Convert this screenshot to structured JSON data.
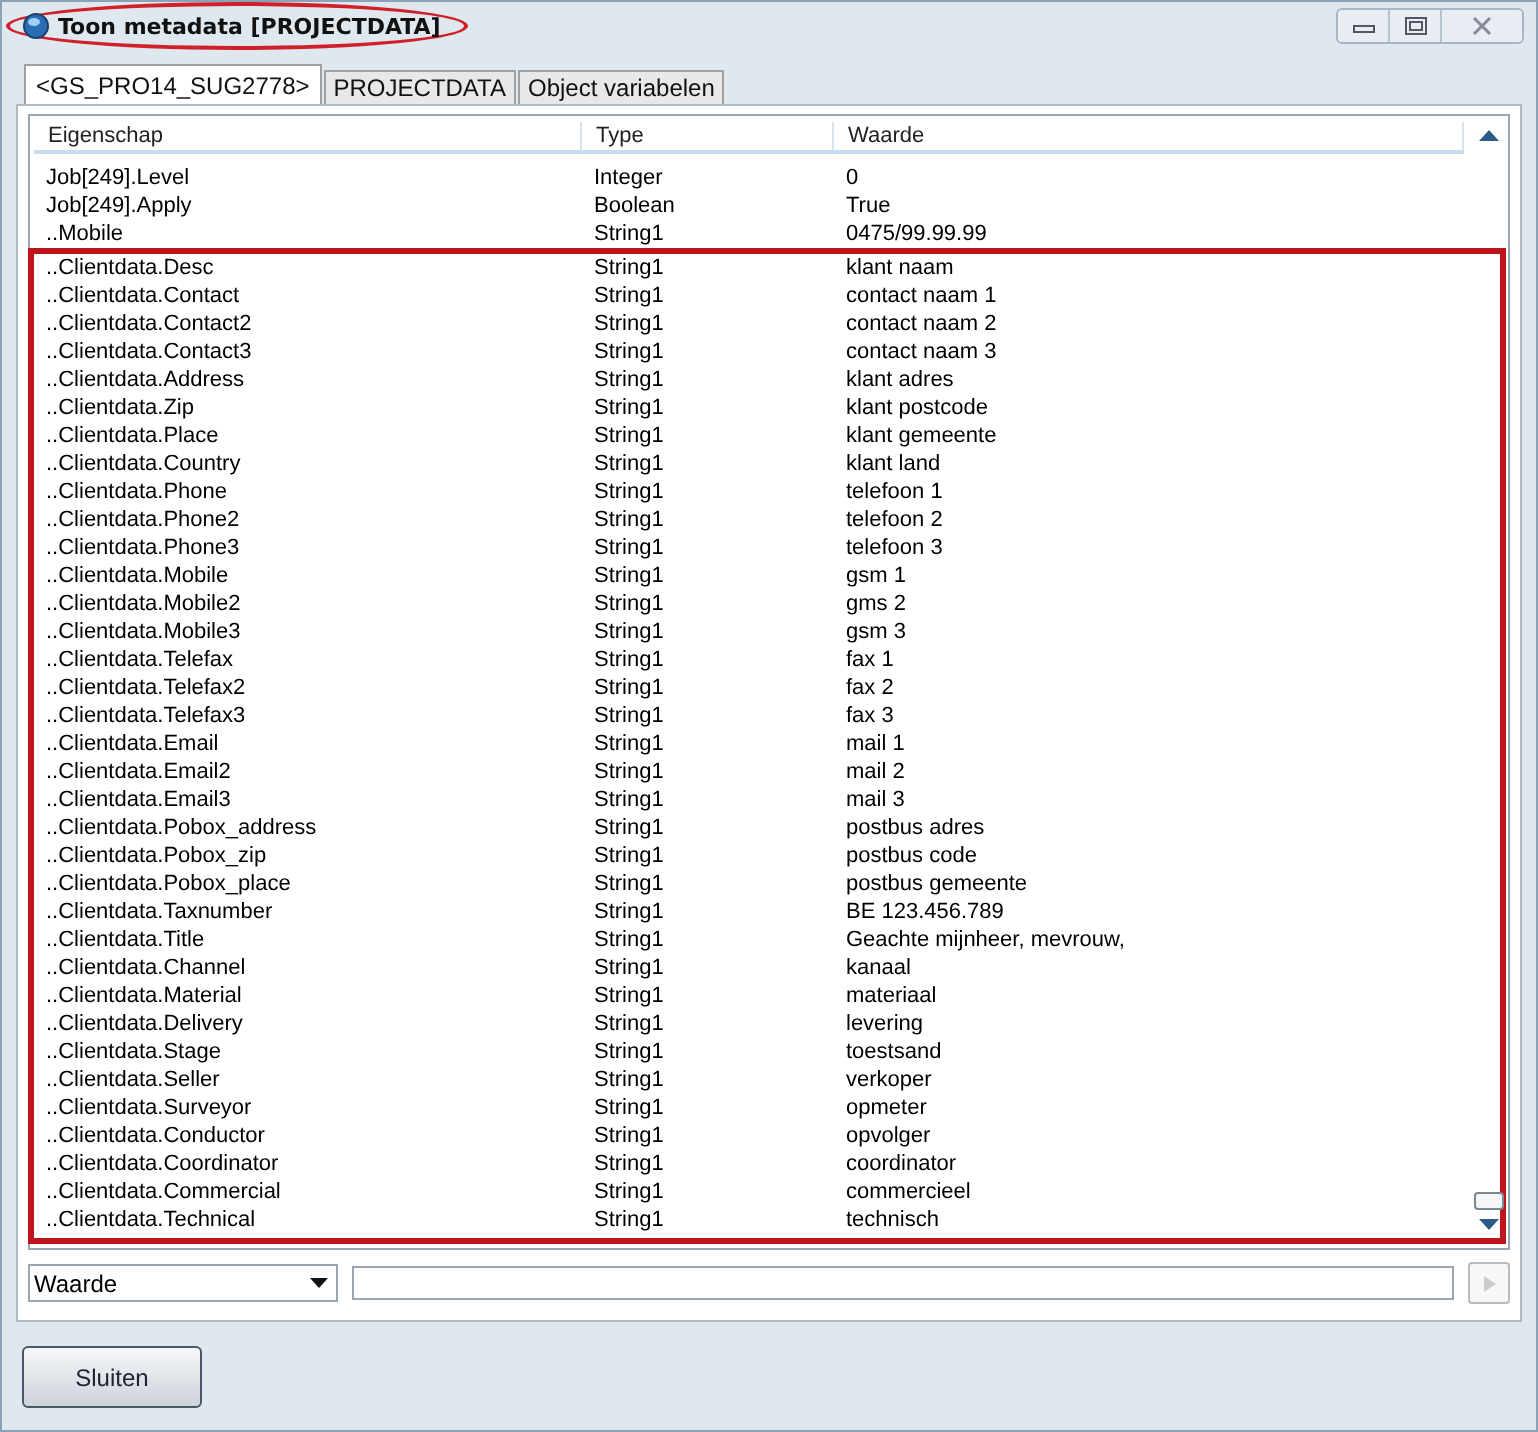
{
  "window": {
    "title": "Toon metadata [PROJECTDATA]"
  },
  "tabs": [
    {
      "label": "<GS_PRO14_SUG2778>",
      "selected": true
    },
    {
      "label": "PROJECTDATA",
      "selected": false
    },
    {
      "label": "Object variabelen",
      "selected": false
    }
  ],
  "table": {
    "columns": [
      "Eigenschap",
      "Type",
      "Waarde"
    ],
    "rows": [
      {
        "cells": [
          "Job[249].Level",
          "Integer",
          "0"
        ],
        "boxed": false
      },
      {
        "cells": [
          "Job[249].Apply",
          "Boolean",
          "True"
        ],
        "boxed": false
      },
      {
        "cells": [
          "..Mobile",
          "String1",
          "0475/99.99.99"
        ],
        "boxed": false
      },
      {
        "cells": [
          "..Clientdata.Desc",
          "String1",
          "klant naam"
        ],
        "boxed": true
      },
      {
        "cells": [
          "..Clientdata.Contact",
          "String1",
          "contact naam 1"
        ],
        "boxed": true
      },
      {
        "cells": [
          "..Clientdata.Contact2",
          "String1",
          "contact naam 2"
        ],
        "boxed": true
      },
      {
        "cells": [
          "..Clientdata.Contact3",
          "String1",
          "contact naam 3"
        ],
        "boxed": true
      },
      {
        "cells": [
          "..Clientdata.Address",
          "String1",
          "klant adres"
        ],
        "boxed": true
      },
      {
        "cells": [
          "..Clientdata.Zip",
          "String1",
          "klant postcode"
        ],
        "boxed": true
      },
      {
        "cells": [
          "..Clientdata.Place",
          "String1",
          "klant gemeente"
        ],
        "boxed": true
      },
      {
        "cells": [
          "..Clientdata.Country",
          "String1",
          "klant land"
        ],
        "boxed": true
      },
      {
        "cells": [
          "..Clientdata.Phone",
          "String1",
          "telefoon 1"
        ],
        "boxed": true
      },
      {
        "cells": [
          "..Clientdata.Phone2",
          "String1",
          "telefoon 2"
        ],
        "boxed": true
      },
      {
        "cells": [
          "..Clientdata.Phone3",
          "String1",
          "telefoon 3"
        ],
        "boxed": true
      },
      {
        "cells": [
          "..Clientdata.Mobile",
          "String1",
          "gsm 1"
        ],
        "boxed": true
      },
      {
        "cells": [
          "..Clientdata.Mobile2",
          "String1",
          "gms 2"
        ],
        "boxed": true
      },
      {
        "cells": [
          "..Clientdata.Mobile3",
          "String1",
          "gsm 3"
        ],
        "boxed": true
      },
      {
        "cells": [
          "..Clientdata.Telefax",
          "String1",
          "fax 1"
        ],
        "boxed": true
      },
      {
        "cells": [
          "..Clientdata.Telefax2",
          "String1",
          "fax 2"
        ],
        "boxed": true
      },
      {
        "cells": [
          "..Clientdata.Telefax3",
          "String1",
          "fax 3"
        ],
        "boxed": true
      },
      {
        "cells": [
          "..Clientdata.Email",
          "String1",
          "mail 1"
        ],
        "boxed": true
      },
      {
        "cells": [
          "..Clientdata.Email2",
          "String1",
          "mail 2"
        ],
        "boxed": true
      },
      {
        "cells": [
          "..Clientdata.Email3",
          "String1",
          "mail 3"
        ],
        "boxed": true
      },
      {
        "cells": [
          "..Clientdata.Pobox_address",
          "String1",
          "postbus adres"
        ],
        "boxed": true
      },
      {
        "cells": [
          "..Clientdata.Pobox_zip",
          "String1",
          "postbus code"
        ],
        "boxed": true
      },
      {
        "cells": [
          "..Clientdata.Pobox_place",
          "String1",
          "postbus gemeente"
        ],
        "boxed": true
      },
      {
        "cells": [
          "..Clientdata.Taxnumber",
          "String1",
          "BE 123.456.789"
        ],
        "boxed": true
      },
      {
        "cells": [
          "..Clientdata.Title",
          "String1",
          "Geachte mijnheer, mevrouw,"
        ],
        "boxed": true
      },
      {
        "cells": [
          "..Clientdata.Channel",
          "String1",
          "kanaal"
        ],
        "boxed": true
      },
      {
        "cells": [
          "..Clientdata.Material",
          "String1",
          "materiaal"
        ],
        "boxed": true
      },
      {
        "cells": [
          "..Clientdata.Delivery",
          "String1",
          "levering"
        ],
        "boxed": true
      },
      {
        "cells": [
          "..Clientdata.Stage",
          "String1",
          "toestsand"
        ],
        "boxed": true
      },
      {
        "cells": [
          "..Clientdata.Seller",
          "String1",
          "verkoper"
        ],
        "boxed": true
      },
      {
        "cells": [
          "..Clientdata.Surveyor",
          "String1",
          "opmeter"
        ],
        "boxed": true
      },
      {
        "cells": [
          "..Clientdata.Conductor",
          "String1",
          "opvolger"
        ],
        "boxed": true
      },
      {
        "cells": [
          "..Clientdata.Coordinator",
          "String1",
          "coordinator"
        ],
        "boxed": true
      },
      {
        "cells": [
          "..Clientdata.Commercial",
          "String1",
          "commercieel"
        ],
        "boxed": true
      },
      {
        "cells": [
          "..Clientdata.Technical",
          "String1",
          "technisch"
        ],
        "boxed": true
      }
    ]
  },
  "filter": {
    "value": "Waarde"
  },
  "apply_button": {
    "disabled": true
  },
  "buttons": [
    "Sluiten"
  ]
}
